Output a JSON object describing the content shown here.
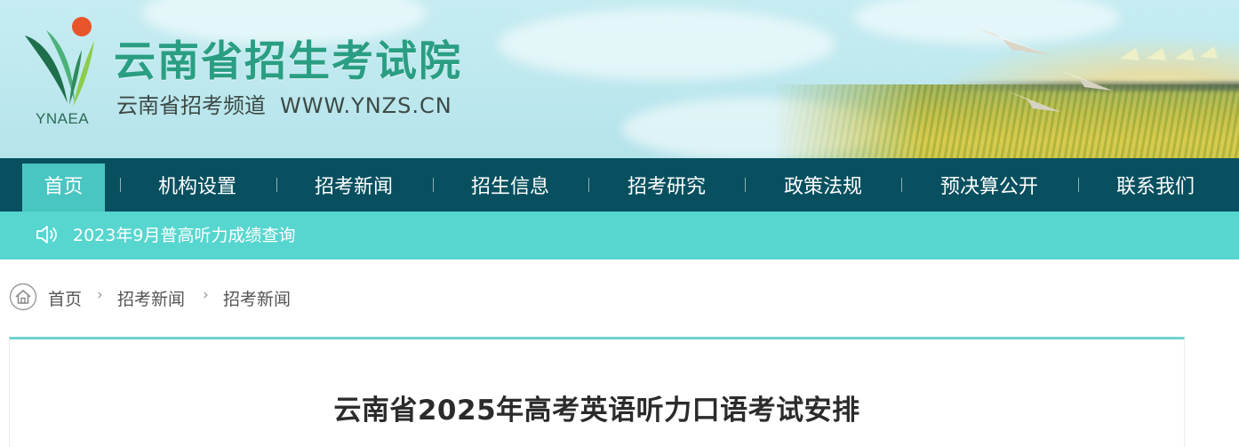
{
  "header": {
    "logo_abbr": "YNAEA",
    "site_title": "云南省招生考试院",
    "subtitle": "云南省招考频道",
    "url": "WWW.YNZS.CN"
  },
  "nav": {
    "items": [
      {
        "label": "首页",
        "active": true
      },
      {
        "label": "机构设置",
        "active": false
      },
      {
        "label": "招考新闻",
        "active": false
      },
      {
        "label": "招生信息",
        "active": false
      },
      {
        "label": "招考研究",
        "active": false
      },
      {
        "label": "政策法规",
        "active": false
      },
      {
        "label": "预决算公开",
        "active": false
      },
      {
        "label": "联系我们",
        "active": false
      }
    ]
  },
  "notice": {
    "icon": "speaker-icon",
    "text": "2023年9月普高听力成绩查询"
  },
  "breadcrumb": {
    "icon": "home-icon",
    "items": [
      "首页",
      "招考新闻",
      "招考新闻"
    ]
  },
  "article": {
    "title": "云南省2025年高考英语听力口语考试安排"
  },
  "colors": {
    "brand_green": "#2a9e82",
    "nav_bg": "#08505f",
    "nav_active": "#49c6c2",
    "notice_bg": "#57d6cf",
    "accent_line": "#6fd3cd"
  }
}
